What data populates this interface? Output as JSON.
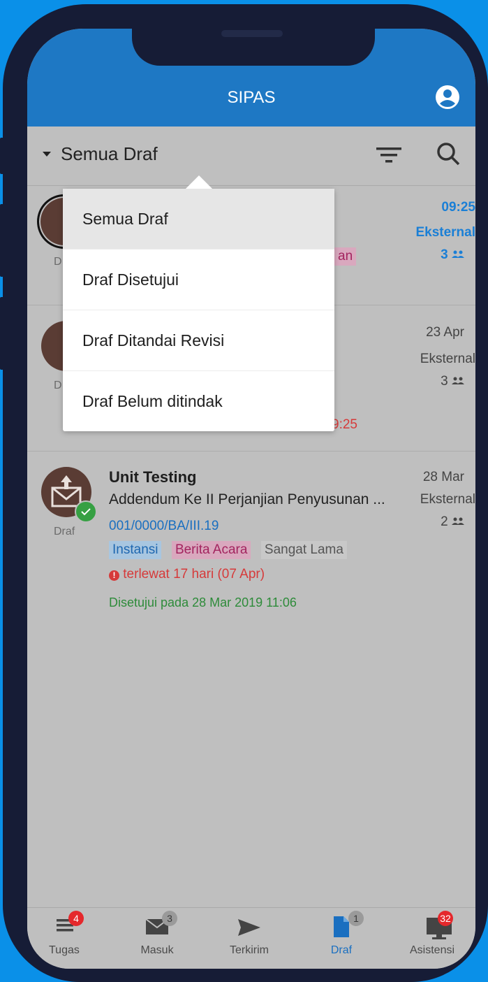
{
  "app": {
    "title": "SIPAS"
  },
  "filter": {
    "current": "Semua Draf"
  },
  "dropdown": {
    "options": [
      "Semua Draf",
      "Draf Disetujui",
      "Draf Ditandai Revisi",
      "Draf Belum ditindak"
    ]
  },
  "items": [
    {
      "draf_label": "D",
      "tag_fragment": "an",
      "time": "09:25",
      "type": "Eksternal",
      "participants": "3"
    },
    {
      "draf_label": "D",
      "footer_fragment": "9:25",
      "time": "23 Apr",
      "type": "Eksternal",
      "participants": "3"
    },
    {
      "draf_label": "Draf",
      "title": "Unit Testing",
      "subtitle": "Addendum Ke II Perjanjian Penyusunan ...",
      "number": "001/0000/BA/III.19",
      "tags": [
        "Instansi",
        "Berita Acara",
        "Sangat Lama"
      ],
      "overdue": "terlewat 17 hari (07 Apr)",
      "approved": "Disetujui pada 28 Mar 2019 11:06",
      "time": "28 Mar",
      "type": "Eksternal",
      "participants": "2"
    }
  ],
  "nav": [
    {
      "label": "Tugas",
      "badge": "4",
      "badge_color": "#e5282c"
    },
    {
      "label": "Masuk",
      "badge": "3",
      "badge_color": "#9a9a9a"
    },
    {
      "label": "Terkirim"
    },
    {
      "label": "Draf",
      "badge": "1",
      "badge_color": "#9a9a9a",
      "active": true
    },
    {
      "label": "Asistensi",
      "badge": "32",
      "badge_color": "#e5282c"
    }
  ],
  "colors": {
    "primary": "#1e78c4",
    "accent_blue": "#1a7fd6",
    "red": "#d63a3a",
    "green": "#2e8b3a"
  }
}
